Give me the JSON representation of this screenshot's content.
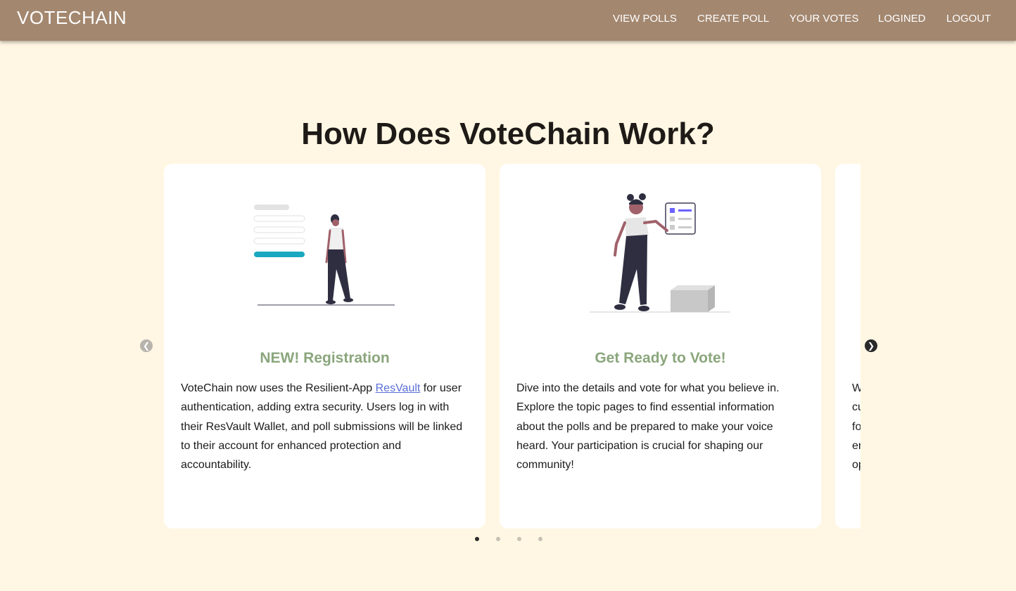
{
  "header": {
    "brand": "VOTECHAIN",
    "nav": [
      "VIEW POLLS",
      "CREATE POLL",
      "YOUR VOTES",
      "LOGINED",
      "LOGOUT"
    ]
  },
  "main": {
    "title": "How Does VoteChain Work?",
    "cards": [
      {
        "title": "NEW! Registration",
        "text_before_link": "VoteChain now uses the Resilient-App ",
        "link": "ResVault",
        "text_after_link": " for user authentication, adding extra security. Users log in with their ResVault Wallet, and poll submissions will be linked to their account for enhanced protection and accountability."
      },
      {
        "title": "Get Ready to Vote!",
        "text": "Dive into the details and vote for what you believe in. Explore the topic pages to find essential information about the polls and be prepared to make your voice heard. Your participation is crucial for shaping our community!"
      }
    ],
    "partial_card_text_fragments": [
      "W",
      "cu",
      "fo",
      "er",
      "op"
    ],
    "carousel": {
      "dot_count": 4,
      "active_index": 0
    }
  },
  "colors": {
    "navbar": "#a3876f",
    "page_background": "#fff7e3",
    "card_title": "#8aa67c",
    "link": "#5a6fd6",
    "accent_teal": "#1aa8c0",
    "accent_purple": "#6c63ff"
  },
  "icons": [
    "chevron-left-icon",
    "chevron-right-icon"
  ]
}
